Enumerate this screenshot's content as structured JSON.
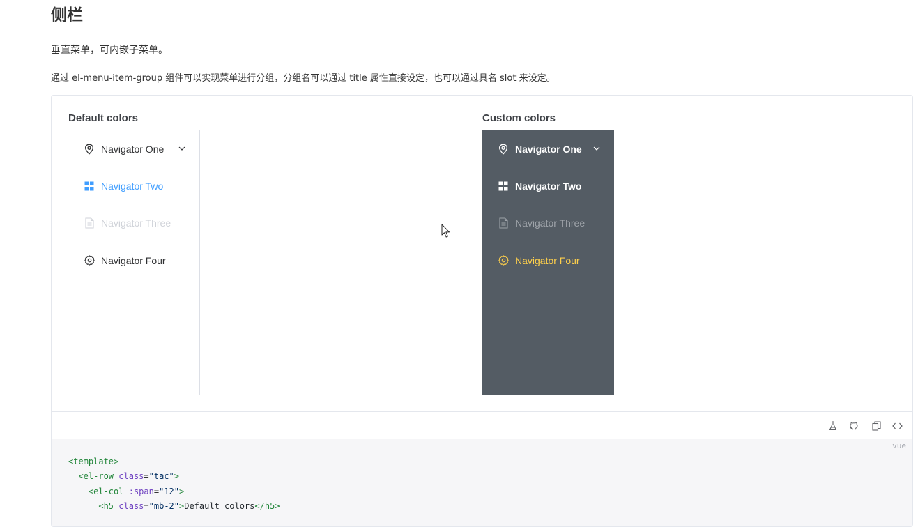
{
  "heading": "侧栏",
  "intro": "垂直菜单，可内嵌子菜单。",
  "description": "通过 el-menu-item-group 组件可以实现菜单进行分组，分组名可以通过 title 属性直接设定，也可以通过具名 slot 来设定。",
  "demo": {
    "default_title": "Default colors",
    "custom_title": "Custom colors",
    "default_menu": [
      {
        "label": "Navigator One",
        "icon": "location-icon",
        "state": "normal",
        "has_submenu": true
      },
      {
        "label": "Navigator Two",
        "icon": "grid-menu-icon",
        "state": "active",
        "has_submenu": false
      },
      {
        "label": "Navigator Three",
        "icon": "document-icon",
        "state": "disabled",
        "has_submenu": false
      },
      {
        "label": "Navigator Four",
        "icon": "setting-icon",
        "state": "normal",
        "has_submenu": false
      }
    ],
    "custom_menu": [
      {
        "label": "Navigator One",
        "icon": "location-icon",
        "state": "normal",
        "has_submenu": true
      },
      {
        "label": "Navigator Two",
        "icon": "grid-menu-icon",
        "state": "normal",
        "has_submenu": false
      },
      {
        "label": "Navigator Three",
        "icon": "document-icon",
        "state": "disabled",
        "has_submenu": false
      },
      {
        "label": "Navigator Four",
        "icon": "setting-icon",
        "state": "active",
        "has_submenu": false
      }
    ],
    "colors": {
      "default_active": "#409eff",
      "custom_background": "#545c64",
      "custom_text": "#ffffff",
      "custom_active": "#ffd04b"
    }
  },
  "toolbar": {
    "buttons": [
      {
        "icon": "flask-icon",
        "name": "playground-button"
      },
      {
        "icon": "github-icon",
        "name": "github-button"
      },
      {
        "icon": "copy-icon",
        "name": "copy-button"
      },
      {
        "icon": "code-icon",
        "name": "view-source-button"
      }
    ]
  },
  "code": {
    "language": "vue",
    "line1_tag": "<template>",
    "line2_open": "<el-row",
    "line2_attr": "class",
    "line2_value": "\"tac\"",
    "line2_close": ">",
    "line3_open": "<el-col",
    "line3_attr": ":span",
    "line3_value": "\"12\"",
    "line3_close": ">",
    "line4_open": "<h5",
    "line4_attr": "class",
    "line4_value": "\"mb-2\"",
    "line4_close": ">",
    "line4_text": "Default colors",
    "line4_end": "</h5>"
  }
}
